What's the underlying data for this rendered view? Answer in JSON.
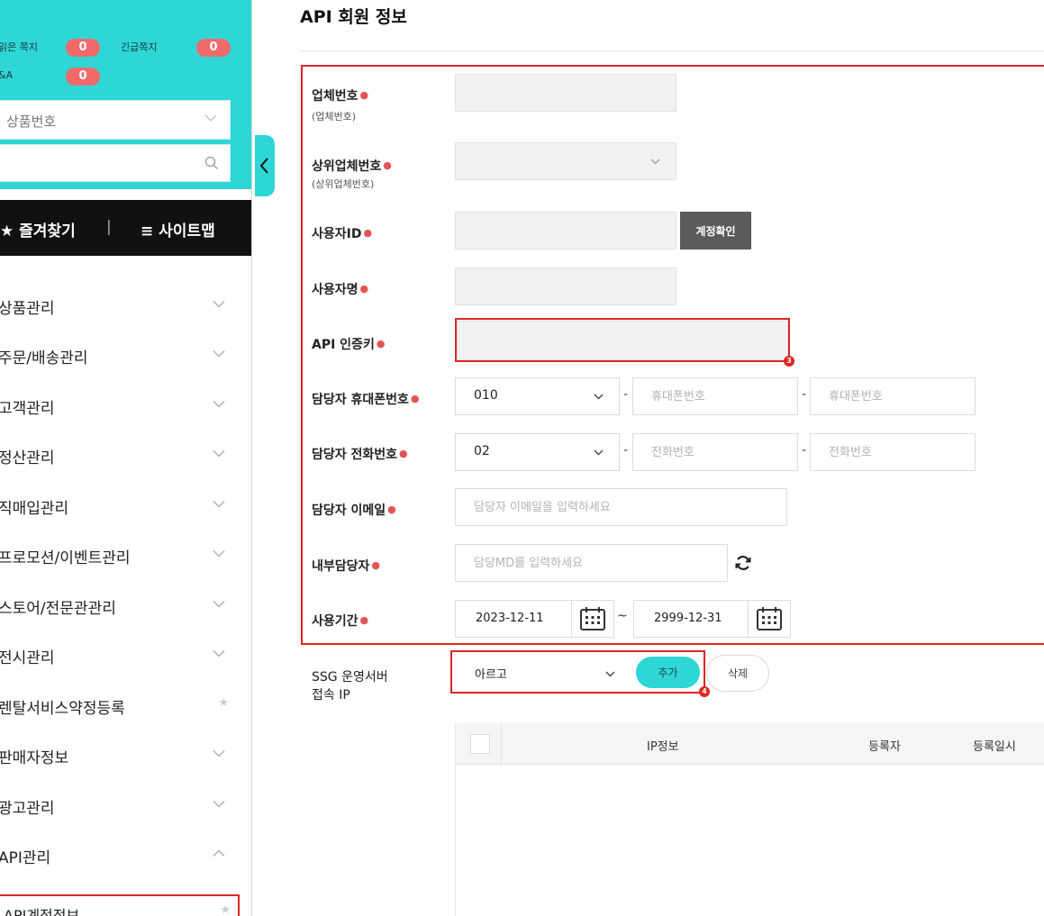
{
  "sidebar": {
    "notices": {
      "unread_label": "읽은 쪽지",
      "unread_count": "0",
      "urgent_label": "긴급쪽지",
      "urgent_count": "0",
      "qa_label": "&A",
      "qa_count": "0"
    },
    "search_select": "상품번호",
    "search_placeholder": "",
    "favorites": "★ 즐겨찾기",
    "separator": "|",
    "sitemap": "≡ 사이트맵",
    "menu": [
      {
        "label": "상품관리",
        "state": "collapsed"
      },
      {
        "label": "주문/배송관리",
        "state": "collapsed"
      },
      {
        "label": "고객관리",
        "state": "collapsed"
      },
      {
        "label": "정산관리",
        "state": "collapsed"
      },
      {
        "label": "직매입관리",
        "state": "collapsed"
      },
      {
        "label": "프로모션/이벤트관리",
        "state": "collapsed"
      },
      {
        "label": "스토어/전문관관리",
        "state": "collapsed"
      },
      {
        "label": "전시관리",
        "state": "collapsed"
      },
      {
        "label": "렌탈서비스약정등록",
        "state": "star"
      },
      {
        "label": "판매자정보",
        "state": "collapsed"
      },
      {
        "label": "광고관리",
        "state": "collapsed"
      },
      {
        "label": "API관리",
        "state": "expanded"
      }
    ],
    "active_submenu": "API계정정보"
  },
  "main": {
    "title": "API 회원 정보",
    "form": {
      "company_no": {
        "label": "업체번호",
        "sub": "(업체번호)",
        "value": ""
      },
      "parent_company_no": {
        "label": "상위업체번호",
        "sub": "(상위업체번호)",
        "value": ""
      },
      "user_id": {
        "label": "사용자ID",
        "value": "",
        "check_button": "계정확인"
      },
      "user_name": {
        "label": "사용자명",
        "value": ""
      },
      "api_key": {
        "label": "API 인증키",
        "value": "",
        "marker": "3"
      },
      "mobile": {
        "label": "담당자 휴대폰번호",
        "prefix": "010",
        "dash": "-",
        "placeholder_mid": "휴대폰번호",
        "placeholder_last": "휴대폰번호"
      },
      "phone": {
        "label": "담당자 전화번호",
        "prefix": "02",
        "dash": "-",
        "placeholder_mid": "전화번호",
        "placeholder_last": "전화번호"
      },
      "email": {
        "label": "담당자 이메일",
        "placeholder": "담당자 이메일을 입력하세요"
      },
      "internal_manager": {
        "label": "내부담당자",
        "placeholder": "담당MD를 입력하세요"
      },
      "period": {
        "label": "사용기간",
        "start": "2023-12-11",
        "end": "2999-12-31",
        "tilde": "~"
      }
    },
    "ip_section": {
      "label_line1": "SSG 운영서버",
      "label_line2": "접속 IP",
      "server_select": "아르고",
      "add_button": "추가",
      "delete_button": "삭제",
      "marker": "4",
      "table_headers": [
        "IP정보",
        "등록자",
        "등록일시"
      ]
    }
  },
  "colors": {
    "accent": "#2fd6d6",
    "highlight_red": "#e02424",
    "badge": "#f06a6a",
    "dark_button": "#5b5b5b"
  }
}
